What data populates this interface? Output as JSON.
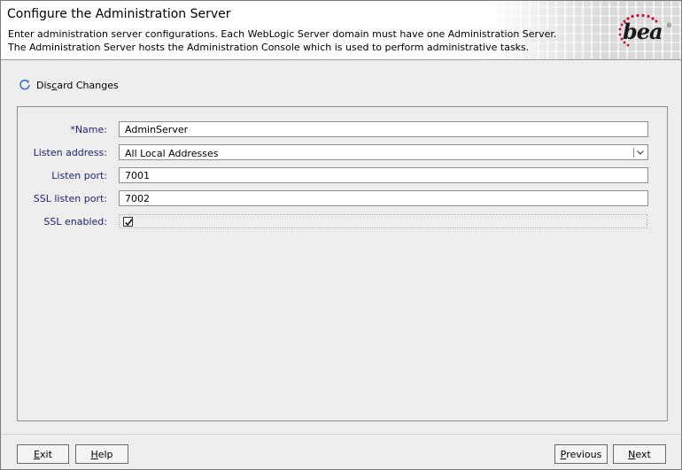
{
  "header": {
    "title": "Configure the Administration Server",
    "description_line1": "Enter administration server configurations. Each WebLogic Server domain must have one Administration Server.",
    "description_line2": "The Administration Server hosts the Administration Console which is used to perform administrative tasks.",
    "logo_text": "bea",
    "logo_mark": "®"
  },
  "toolbar": {
    "discard_prefix": "Dis",
    "discard_mnemonic": "c",
    "discard_suffix": "ard Changes",
    "discard_icon": "refresh-icon"
  },
  "form": {
    "name_label": "*Name:",
    "name_value": "AdminServer",
    "listen_address_label": "Listen address:",
    "listen_address_value": "All Local Addresses",
    "listen_port_label": "Listen port:",
    "listen_port_value": "7001",
    "ssl_port_label": "SSL listen port:",
    "ssl_port_value": "7002",
    "ssl_enabled_label": "SSL enabled:",
    "ssl_enabled": true
  },
  "buttons": {
    "exit_mnemonic": "E",
    "exit_rest": "xit",
    "help_mnemonic": "H",
    "help_rest": "elp",
    "previous_mnemonic": "P",
    "previous_rest": "revious",
    "next_mnemonic": "N",
    "next_rest": "ext"
  },
  "colors": {
    "label": "#1f1f6e",
    "accent": "#3a74c4",
    "logo_red": "#c8102e"
  }
}
